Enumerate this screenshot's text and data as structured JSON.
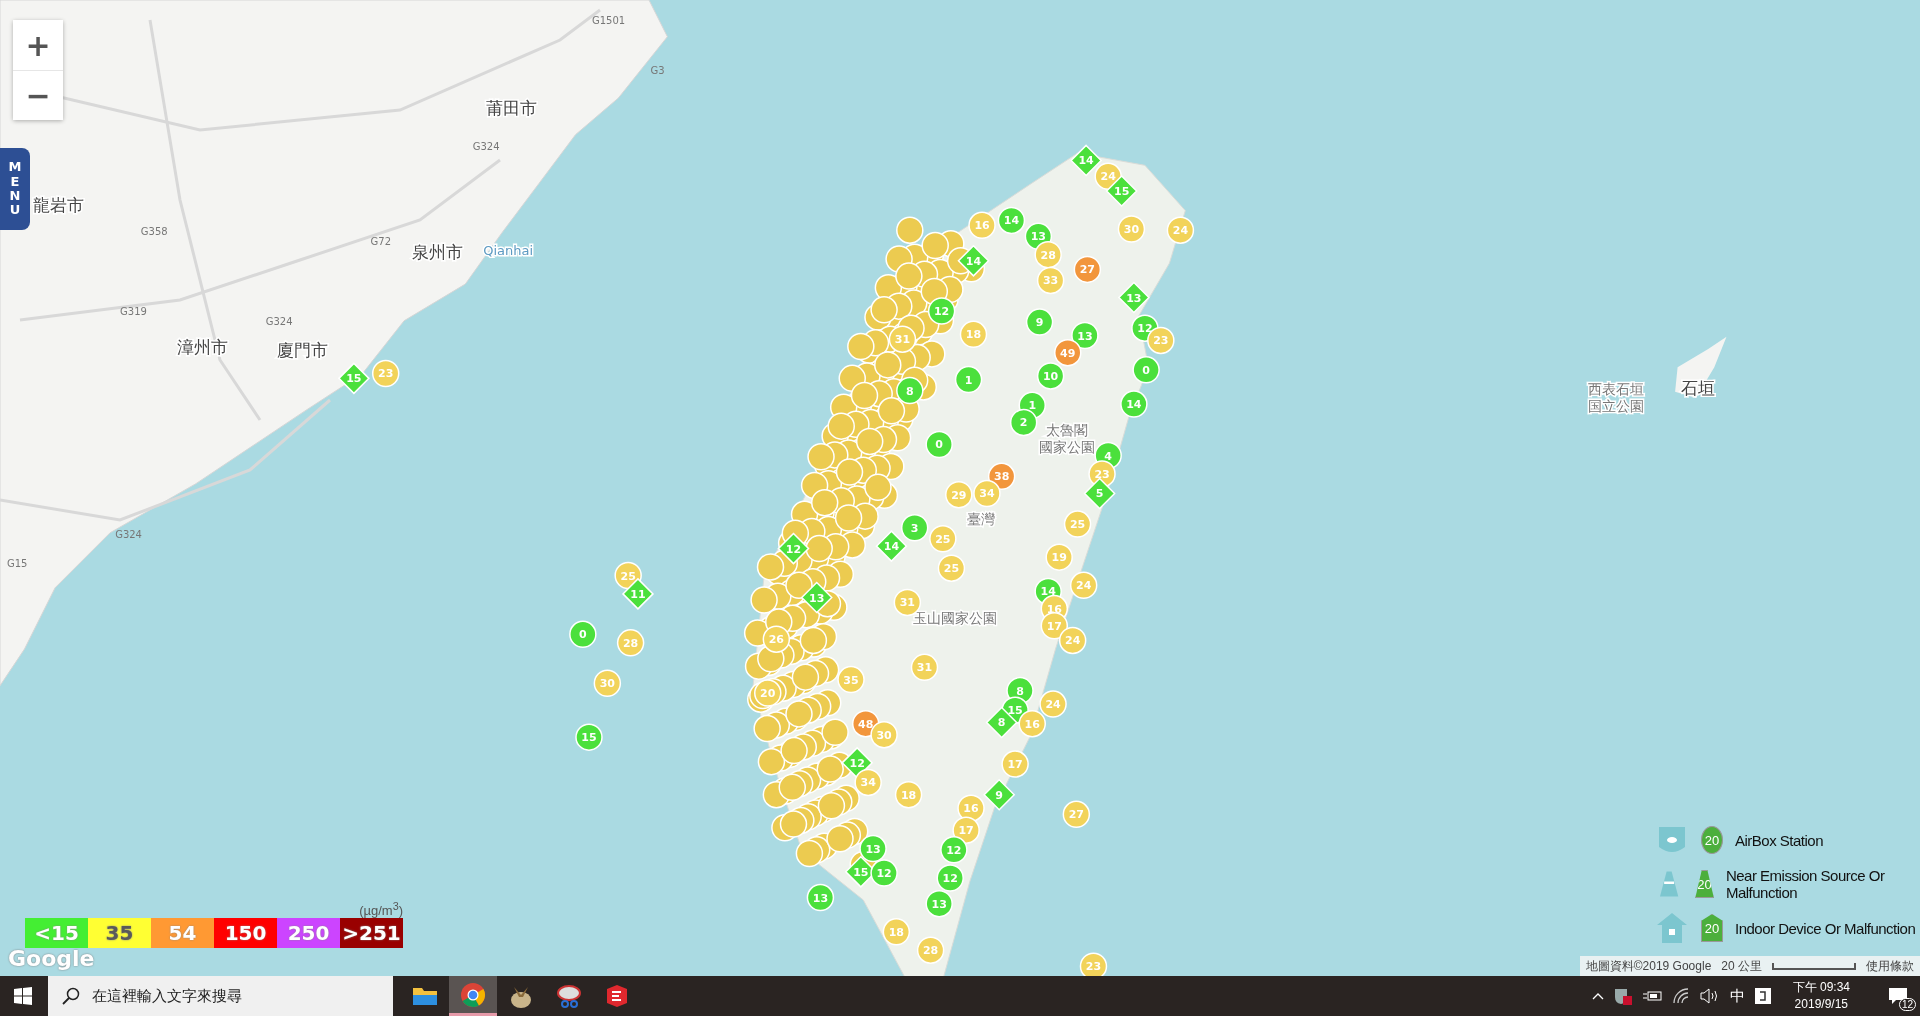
{
  "map": {
    "zoom_controls": [
      "+",
      "−"
    ],
    "menu_tab": "MENU",
    "place_labels": [
      {
        "text": "莆田市",
        "kind": "city"
      },
      {
        "text": "龍岩市",
        "kind": "city"
      },
      {
        "text": "泉州市",
        "kind": "city"
      },
      {
        "text": "漳州市",
        "kind": "city"
      },
      {
        "text": "廈門市",
        "kind": "city"
      },
      {
        "text": "Qianhai",
        "kind": "water"
      },
      {
        "text": "石垣",
        "kind": "city"
      },
      {
        "text": "西表石垣",
        "kind": "park"
      },
      {
        "text": "国立公園",
        "kind": "park"
      },
      {
        "text": "太魯閣",
        "kind": "park"
      },
      {
        "text": "國家公園",
        "kind": "park"
      },
      {
        "text": "玉山國家公園",
        "kind": "park"
      },
      {
        "text": "臺灣",
        "kind": "park"
      }
    ],
    "road_labels": [
      "G1501",
      "G3",
      "G324",
      "G72",
      "G358",
      "G319",
      "G324",
      "G324",
      "G15"
    ],
    "markers": [
      {
        "value": "14",
        "kind": "diamond",
        "color": "#4be03c"
      },
      {
        "value": "24",
        "kind": "circle",
        "color": "#f2d35a"
      },
      {
        "value": "15",
        "kind": "diamond",
        "color": "#4be03c"
      },
      {
        "value": "16",
        "kind": "circle",
        "color": "#f2d35a"
      },
      {
        "value": "14",
        "kind": "circle",
        "color": "#4be03c"
      },
      {
        "value": "30",
        "kind": "circle",
        "color": "#f2d35a"
      },
      {
        "value": "24",
        "kind": "circle",
        "color": "#f2d35a"
      },
      {
        "value": "13",
        "kind": "circle",
        "color": "#4be03c"
      },
      {
        "value": "28",
        "kind": "circle",
        "color": "#f2d35a"
      },
      {
        "value": "14",
        "kind": "diamond",
        "color": "#4be03c"
      },
      {
        "value": "27",
        "kind": "circle",
        "color": "#f2963c"
      },
      {
        "value": "33",
        "kind": "circle",
        "color": "#f2d35a"
      },
      {
        "value": "13",
        "kind": "diamond",
        "color": "#4be03c"
      },
      {
        "value": "12",
        "kind": "circle",
        "color": "#4be03c"
      },
      {
        "value": "9",
        "kind": "circle",
        "color": "#4be03c"
      },
      {
        "value": "31",
        "kind": "circle",
        "color": "#f2d35a"
      },
      {
        "value": "18",
        "kind": "circle",
        "color": "#f2d35a"
      },
      {
        "value": "13",
        "kind": "circle",
        "color": "#4be03c"
      },
      {
        "value": "12",
        "kind": "circle",
        "color": "#4be03c"
      },
      {
        "value": "23",
        "kind": "circle",
        "color": "#f2d35a"
      },
      {
        "value": "49",
        "kind": "circle",
        "color": "#f2963c"
      },
      {
        "value": "15",
        "kind": "diamond",
        "color": "#4be03c"
      },
      {
        "value": "23",
        "kind": "circle",
        "color": "#f2d35a"
      },
      {
        "value": "1",
        "kind": "circle",
        "color": "#4be03c"
      },
      {
        "value": "10",
        "kind": "circle",
        "color": "#4be03c"
      },
      {
        "value": "0",
        "kind": "circle",
        "color": "#4be03c"
      },
      {
        "value": "8",
        "kind": "circle",
        "color": "#4be03c"
      },
      {
        "value": "1",
        "kind": "circle",
        "color": "#4be03c"
      },
      {
        "value": "14",
        "kind": "circle",
        "color": "#4be03c"
      },
      {
        "value": "2",
        "kind": "circle",
        "color": "#4be03c"
      },
      {
        "value": "0",
        "kind": "circle",
        "color": "#4be03c"
      },
      {
        "value": "4",
        "kind": "circle",
        "color": "#4be03c"
      },
      {
        "value": "38",
        "kind": "circle",
        "color": "#f2963c"
      },
      {
        "value": "23",
        "kind": "circle",
        "color": "#f2d35a"
      },
      {
        "value": "29",
        "kind": "circle",
        "color": "#f2d35a"
      },
      {
        "value": "34",
        "kind": "circle",
        "color": "#f2d35a"
      },
      {
        "value": "5",
        "kind": "diamond",
        "color": "#4be03c"
      },
      {
        "value": "3",
        "kind": "circle",
        "color": "#4be03c"
      },
      {
        "value": "25",
        "kind": "circle",
        "color": "#f2d35a"
      },
      {
        "value": "25",
        "kind": "circle",
        "color": "#f2d35a"
      },
      {
        "value": "12",
        "kind": "diamond",
        "color": "#4be03c"
      },
      {
        "value": "14",
        "kind": "diamond",
        "color": "#4be03c"
      },
      {
        "value": "19",
        "kind": "circle",
        "color": "#f2d35a"
      },
      {
        "value": "25",
        "kind": "circle",
        "color": "#f2d35a"
      },
      {
        "value": "25",
        "kind": "circle",
        "color": "#f2d35a"
      },
      {
        "value": "11",
        "kind": "diamond",
        "color": "#4be03c"
      },
      {
        "value": "13",
        "kind": "diamond",
        "color": "#4be03c"
      },
      {
        "value": "31",
        "kind": "circle",
        "color": "#f2d35a"
      },
      {
        "value": "14",
        "kind": "circle",
        "color": "#4be03c"
      },
      {
        "value": "16",
        "kind": "circle",
        "color": "#f2d35a"
      },
      {
        "value": "24",
        "kind": "circle",
        "color": "#f2d35a"
      },
      {
        "value": "17",
        "kind": "circle",
        "color": "#f2d35a"
      },
      {
        "value": "0",
        "kind": "circle",
        "color": "#4be03c"
      },
      {
        "value": "28",
        "kind": "circle",
        "color": "#f2d35a"
      },
      {
        "value": "26",
        "kind": "circle",
        "color": "#f2d35a"
      },
      {
        "value": "24",
        "kind": "circle",
        "color": "#f2d35a"
      },
      {
        "value": "31",
        "kind": "circle",
        "color": "#f2d35a"
      },
      {
        "value": "30",
        "kind": "circle",
        "color": "#f2d35a"
      },
      {
        "value": "35",
        "kind": "circle",
        "color": "#f2d35a"
      },
      {
        "value": "20",
        "kind": "circle",
        "color": "#f2d35a"
      },
      {
        "value": "8",
        "kind": "circle",
        "color": "#4be03c"
      },
      {
        "value": "15",
        "kind": "circle",
        "color": "#4be03c"
      },
      {
        "value": "24",
        "kind": "circle",
        "color": "#f2d35a"
      },
      {
        "value": "48",
        "kind": "circle",
        "color": "#f2963c"
      },
      {
        "value": "8",
        "kind": "diamond",
        "color": "#4be03c"
      },
      {
        "value": "16",
        "kind": "circle",
        "color": "#f2d35a"
      },
      {
        "value": "15",
        "kind": "circle",
        "color": "#4be03c"
      },
      {
        "value": "30",
        "kind": "circle",
        "color": "#f2d35a"
      },
      {
        "value": "12",
        "kind": "diamond",
        "color": "#4be03c"
      },
      {
        "value": "17",
        "kind": "circle",
        "color": "#f2d35a"
      },
      {
        "value": "34",
        "kind": "circle",
        "color": "#f2d35a"
      },
      {
        "value": "18",
        "kind": "circle",
        "color": "#f2d35a"
      },
      {
        "value": "9",
        "kind": "diamond",
        "color": "#4be03c"
      },
      {
        "value": "16",
        "kind": "circle",
        "color": "#f2d35a"
      },
      {
        "value": "27",
        "kind": "circle",
        "color": "#f2d35a"
      },
      {
        "value": "17",
        "kind": "circle",
        "color": "#f2d35a"
      },
      {
        "value": "13",
        "kind": "circle",
        "color": "#4be03c"
      },
      {
        "value": "12",
        "kind": "circle",
        "color": "#4be03c"
      },
      {
        "value": "15",
        "kind": "diamond",
        "color": "#4be03c"
      },
      {
        "value": "12",
        "kind": "circle",
        "color": "#4be03c"
      },
      {
        "value": "12",
        "kind": "circle",
        "color": "#4be03c"
      },
      {
        "value": "13",
        "kind": "circle",
        "color": "#4be03c"
      },
      {
        "value": "13",
        "kind": "circle",
        "color": "#4be03c"
      },
      {
        "value": "18",
        "kind": "circle",
        "color": "#f2d35a"
      },
      {
        "value": "28",
        "kind": "circle",
        "color": "#f2d35a"
      },
      {
        "value": "23",
        "kind": "circle",
        "color": "#f2d35a"
      }
    ],
    "pm_legend": {
      "unit": "(µg/m$^{3}$)",
      "bands": [
        {
          "label": "<15",
          "color": "#44ee33"
        },
        {
          "label": "35",
          "color": "#ffff33"
        },
        {
          "label": "54",
          "color": "#ff9933"
        },
        {
          "label": "150",
          "color": "#ff0000"
        },
        {
          "label": "250",
          "color": "#cc44ff"
        },
        {
          "label": ">251",
          "color": "#990000"
        }
      ]
    },
    "station_legend": [
      {
        "kind": "airbox",
        "label": "AirBox Station",
        "badge": "20"
      },
      {
        "kind": "emission",
        "label": "Near Emission Source Or Malfunction",
        "badge": "20"
      },
      {
        "kind": "indoor",
        "label": "Indoor Device Or Malfunction",
        "badge": "20"
      }
    ],
    "google_logo": "Google",
    "attribution": {
      "data": "地圖資料©2019 Google",
      "scale": "20 公里",
      "terms": "使用條款"
    }
  },
  "taskbar": {
    "search_placeholder": "在這裡輸入文字來搜尋",
    "ime": "中",
    "time": "下午 09:34",
    "date": "2019/9/15",
    "notifications": "12"
  }
}
